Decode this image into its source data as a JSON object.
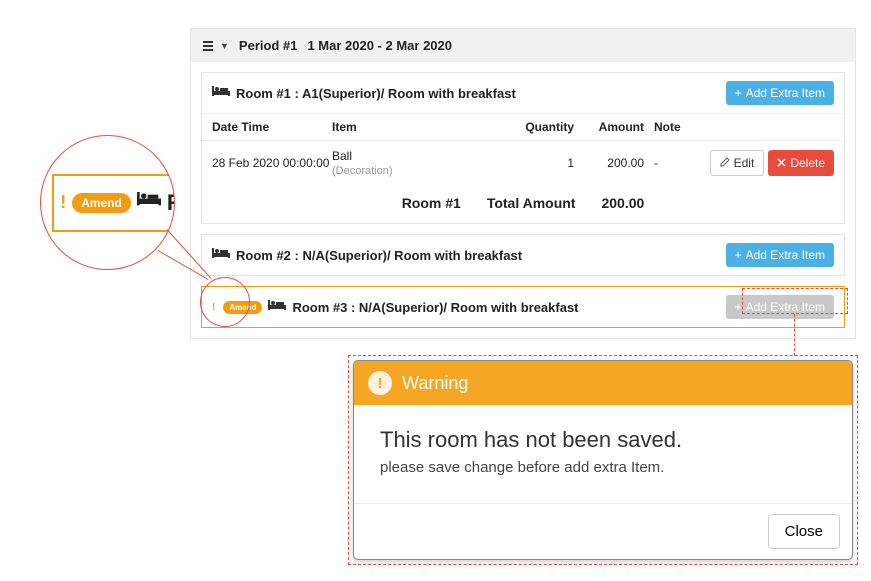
{
  "period": {
    "label": "Period #1",
    "range": "1 Mar 2020 - 2 Mar 2020"
  },
  "headers": {
    "datetime": "Date Time",
    "item": "Item",
    "qty": "Quantity",
    "amount": "Amount",
    "note": "Note"
  },
  "buttons": {
    "add_extra": "Add Extra Item",
    "edit": "Edit",
    "delete": "Delete",
    "close": "Close"
  },
  "rooms": [
    {
      "title": "Room #1 : A1(Superior)/ Room with breakfast",
      "items": [
        {
          "datetime": "28 Feb 2020 00:00:00",
          "name": "Ball",
          "sub": "(Decoration)",
          "qty": "1",
          "amount": "200.00",
          "note": "-"
        }
      ],
      "total": {
        "label": "Room #1",
        "amount_label": "Total Amount",
        "amount": "200.00"
      }
    },
    {
      "title": "Room #2 : N/A(Superior)/ Room with breakfast"
    },
    {
      "title": "Room #3 : N/A(Superior)/ Room with breakfast",
      "amend": true
    }
  ],
  "amend_label": "Amend",
  "magnifier": {
    "amend": "Amend",
    "letter": "R"
  },
  "warning": {
    "title": "Warning",
    "headline": "This room has not been saved.",
    "detail": "please save change before add extra Item."
  }
}
